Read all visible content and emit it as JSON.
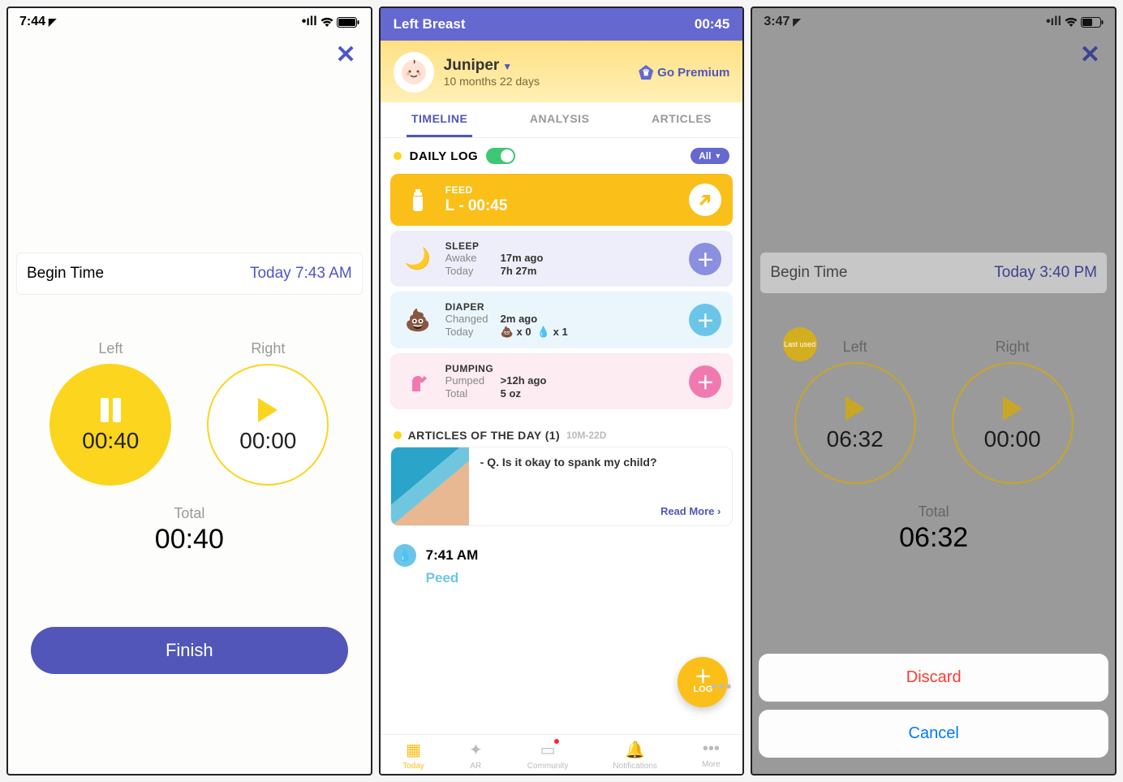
{
  "screen1": {
    "status_time": "7:44",
    "begin_label": "Begin Time",
    "begin_value": "Today 7:43 AM",
    "left_label": "Left",
    "right_label": "Right",
    "left_time": "00:40",
    "right_time": "00:00",
    "total_label": "Total",
    "total_value": "00:40",
    "finish": "Finish"
  },
  "screen2": {
    "bar_title": "Left Breast",
    "bar_time": "00:45",
    "baby_name": "Juniper",
    "baby_age": "10 months 22 days",
    "premium": "Go Premium",
    "tabs": {
      "timeline": "TIMELINE",
      "analysis": "ANALYSIS",
      "articles": "ARTICLES"
    },
    "dailylog": "DAILY LOG",
    "all": "All",
    "feed": {
      "title": "FEED",
      "sub": "L - 00:45"
    },
    "sleep": {
      "title": "SLEEP",
      "k1": "Awake",
      "v1": "17m ago",
      "k2": "Today",
      "v2": "7h 27m"
    },
    "diaper": {
      "title": "DIAPER",
      "k1": "Changed",
      "v1": "2m ago",
      "k2": "Today",
      "v2a": "x 0",
      "v2b": "x 1"
    },
    "pump": {
      "title": "PUMPING",
      "k1": "Pumped",
      "v1": ">12h ago",
      "k2": "Total",
      "v2": "5 oz"
    },
    "articles_title": "ARTICLES OF THE DAY (1)",
    "articles_sub": "10M-22D",
    "article_q": "- Q. Is it okay to spank my child?",
    "read_more": "Read More ›",
    "tl_time": "7:41 AM",
    "peed": "Peed",
    "fab": "LOG",
    "nav": {
      "today": "Today",
      "ar": "AR",
      "community": "Community",
      "notif": "Notifications",
      "more": "More"
    }
  },
  "screen3": {
    "status_time": "3:47",
    "begin_label": "Begin Time",
    "begin_value": "Today 3:40 PM",
    "left_label": "Left",
    "right_label": "Right",
    "left_time": "06:32",
    "right_time": "00:00",
    "last_used": "Last used",
    "total_label": "Total",
    "total_value": "06:32",
    "discard": "Discard",
    "cancel": "Cancel"
  }
}
